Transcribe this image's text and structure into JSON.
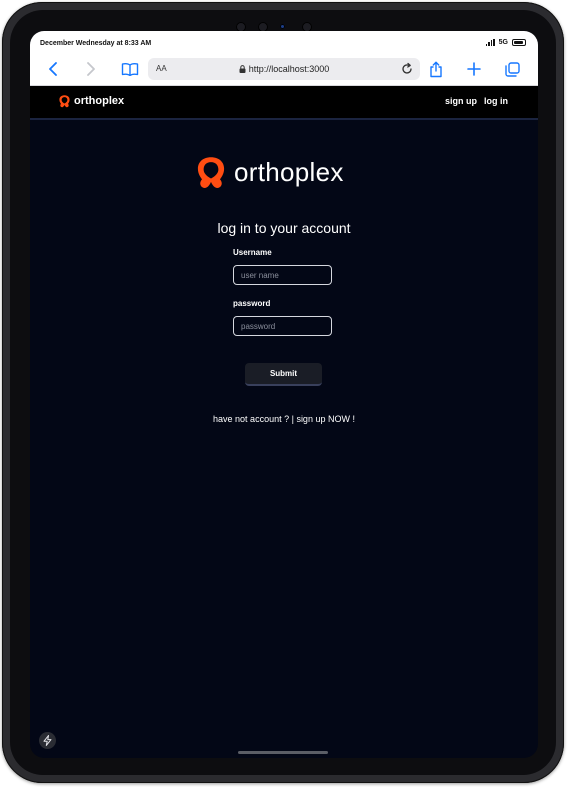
{
  "status": {
    "time": "December Wednesday at 8:33 AM",
    "network": "5G"
  },
  "browser": {
    "aa_label": "AA",
    "url": "http://localhost:3000"
  },
  "nav": {
    "brand": "orthoplex",
    "signup_label": "sign up",
    "login_label": "log in"
  },
  "page": {
    "logo_text": "orthoplex",
    "title": "log in to your account",
    "username_label": "Username",
    "username_placeholder": "user name",
    "username_value": "",
    "password_label": "password",
    "password_placeholder": "password",
    "password_value": "",
    "submit_label": "Submit",
    "signup_prompt": "have not account ? | ",
    "signup_link": "sign up NOW !"
  },
  "colors": {
    "accent_orange": "#ff4d12",
    "page_background": "#030716",
    "navbar_background": "#000000",
    "browser_link_blue": "#1677ff"
  },
  "icons": [
    "back-arrow-icon",
    "forward-arrow-icon",
    "bookmarks-book-icon",
    "lock-icon",
    "reload-icon",
    "share-icon",
    "new-tab-plus-icon",
    "tabs-overview-icon",
    "orthoplex-logo-icon",
    "bolt-icon"
  ]
}
